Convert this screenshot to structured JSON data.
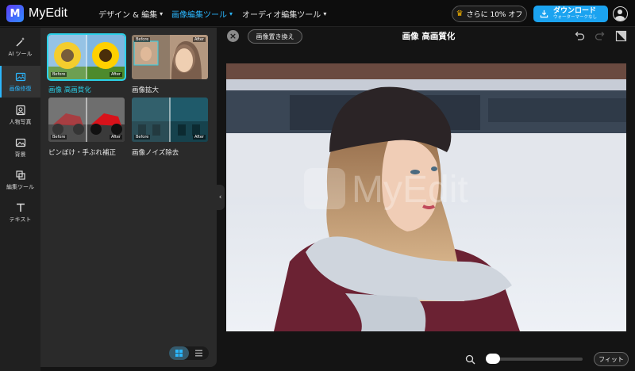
{
  "app": {
    "name": "MyEdit",
    "logo_glyph": "M",
    "accent": "#2bb7ff"
  },
  "nav": [
    {
      "label": "デザイン & 編集",
      "active": false
    },
    {
      "label": "画像編集ツール",
      "active": true
    },
    {
      "label": "オーディオ編集ツール",
      "active": false
    }
  ],
  "promo": {
    "label": "さらに 10% オフ",
    "icon": "crown-icon"
  },
  "download": {
    "main": "ダウンロード",
    "sub": "ウォーターマークなし",
    "color": "#1ba3f0"
  },
  "rail": [
    {
      "label": "AI ツール",
      "icon": "magic-wand-icon"
    },
    {
      "label": "画像修復",
      "icon": "image-repair-icon",
      "active": true
    },
    {
      "label": "人物写真",
      "icon": "portrait-icon"
    },
    {
      "label": "背景",
      "icon": "background-icon"
    },
    {
      "label": "編集ツール",
      "icon": "crop-icon"
    },
    {
      "label": "テキスト",
      "icon": "text-icon"
    }
  ],
  "tools": [
    {
      "label": "画像 高画質化",
      "before": "Before",
      "after": "After",
      "active": true
    },
    {
      "label": "画像拡大",
      "before": "Before",
      "after": "After"
    },
    {
      "label": "ピンぼけ・手ぶれ補正",
      "before": "Before",
      "after": "After"
    },
    {
      "label": "画像ノイズ除去",
      "before": "Before",
      "after": "After"
    }
  ],
  "editor": {
    "replace_label": "画像置き換え",
    "title": "画像 高画質化",
    "watermark": "MyEdit",
    "fit_label": "フィット"
  }
}
